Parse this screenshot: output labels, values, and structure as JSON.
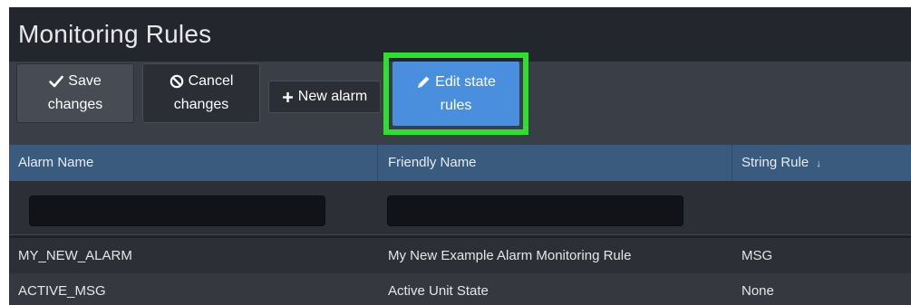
{
  "page": {
    "title": "Monitoring Rules"
  },
  "toolbar": {
    "save_line1": "Save",
    "save_line2": "changes",
    "cancel_line1": "Cancel",
    "cancel_line2": "changes",
    "new_alarm_label": "New alarm",
    "edit_line1": "Edit state",
    "edit_line2": "rules"
  },
  "table": {
    "columns": [
      "Alarm Name",
      "Friendly Name",
      "String Rule"
    ],
    "sort_indicator": "↓",
    "filters": {
      "alarm_name": "",
      "friendly_name": ""
    },
    "rows": [
      {
        "alarm_name": "MY_NEW_ALARM",
        "friendly_name": "My New Example Alarm Monitoring Rule",
        "string_rule": "MSG"
      },
      {
        "alarm_name": "ACTIVE_MSG",
        "friendly_name": "Active Unit State",
        "string_rule": "None"
      }
    ]
  },
  "icons": {
    "save": "check-icon",
    "cancel": "ban-icon",
    "new": "plus-icon",
    "edit": "pencil-icon",
    "sort": "sort-down-icon"
  },
  "colors": {
    "highlight": "#2ee02e",
    "primary_button": "#4a8fde",
    "header_row": "#3a5b7e",
    "background": "#1f2229"
  }
}
